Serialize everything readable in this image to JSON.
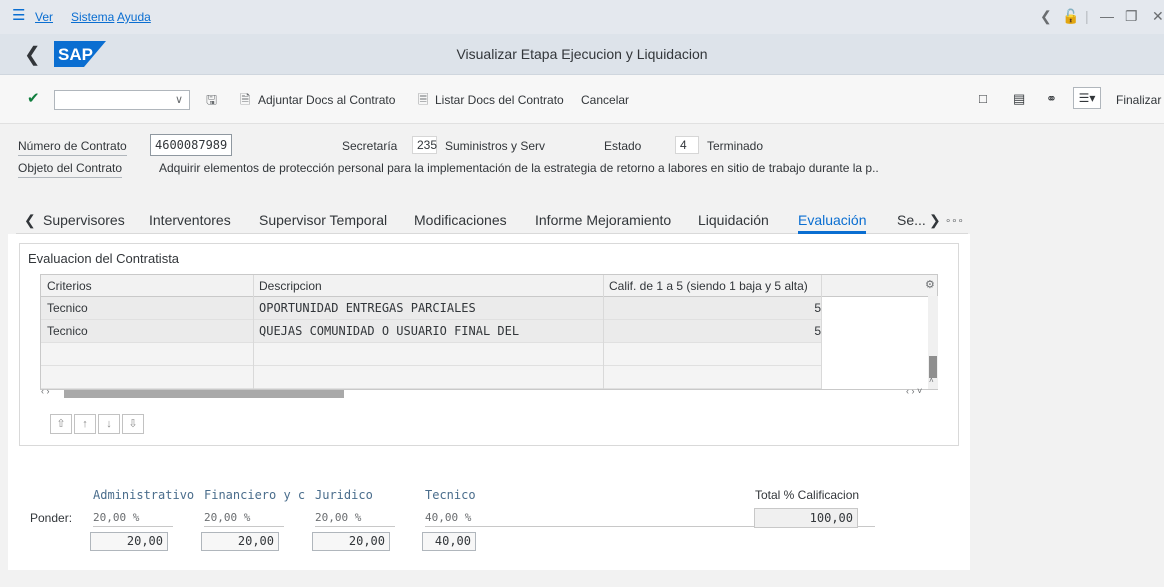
{
  "menu": {
    "items": [
      "Ver",
      "Sistema",
      "Ayuda"
    ]
  },
  "window": {
    "title": "Visualizar Etapa Ejecucion y Liquidacion",
    "logo": "SAP"
  },
  "toolbar": {
    "adjuntar": "Adjuntar Docs al Contrato",
    "listar": "Listar Docs del Contrato",
    "cancelar": "Cancelar",
    "finalizar": "Finalizar",
    "command_value": ""
  },
  "header": {
    "numero_label": "Número de Contrato",
    "numero_value": "4600087989",
    "secretaria_label": "Secretaría",
    "secretaria_code": "235",
    "secretaria_text": "Suministros y Serv",
    "estado_label": "Estado",
    "estado_code": "4",
    "estado_text": "Terminado",
    "objeto_label": "Objeto del Contrato",
    "objeto_value": "Adquirir elementos de protección personal para la implementación de la  estrategia de retorno a labores en sitio de trabajo durante la p.."
  },
  "tabs": [
    "Supervisores",
    "Interventores",
    "Supervisor Temporal",
    "Modificaciones",
    "Informe Mejoramiento",
    "Liquidación",
    "Evaluación",
    "Se..."
  ],
  "active_tab": "Evaluación",
  "evaluacion": {
    "title": "Evaluacion del Contratista",
    "columns": [
      "Criterios",
      "Descripcion",
      "Calif. de 1 a 5 (siendo 1 baja y 5 alta)"
    ],
    "rows": [
      {
        "criterio": "Tecnico",
        "descripcion": "OPORTUNIDAD ENTREGAS PARCIALES",
        "calif": "5"
      },
      {
        "criterio": "Tecnico",
        "descripcion": "QUEJAS COMUNIDAD O USUARIO FINAL DEL BIEN/SERVICIO",
        "calif": "5"
      }
    ]
  },
  "ponder": {
    "label": "Ponder:",
    "categories": [
      {
        "name": "Administrativo",
        "pct": "20,00 %",
        "value": "20,00"
      },
      {
        "name": "Financiero y c",
        "pct": "20,00 %",
        "value": "20,00"
      },
      {
        "name": "Juridico",
        "pct": "20,00 %",
        "value": "20,00"
      },
      {
        "name": "Tecnico",
        "pct": "40,00 %",
        "value": "40,00"
      }
    ],
    "total_label": "Total % Calificacion",
    "total_value": "100,00"
  },
  "colors": {
    "accent": "#0a6ed1",
    "sap_blue": "#0a6ed1",
    "accept_green": "#107e3e"
  }
}
